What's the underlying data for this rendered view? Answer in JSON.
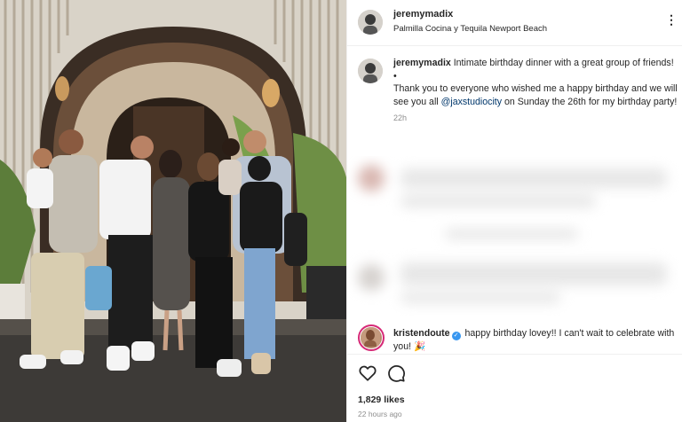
{
  "post": {
    "username": "jeremymadix",
    "location": "Palmilla Cocina y Tequila Newport Beach",
    "more_icon": "more-dots-icon"
  },
  "caption": {
    "username": "jeremymadix",
    "text_1": " Intimate birthday dinner with a great group of friends!",
    "bullet": "•",
    "text_2": "Thank you to everyone who wished me a happy birthday and we will see you all ",
    "mention": "@jaxstudiocity",
    "text_3": " on Sunday the 26th for my birthday party!",
    "time": "22h"
  },
  "comment": {
    "username": "kristendoute",
    "verified_icon": "verified-badge-icon",
    "text": " happy birthday lovey!! I can't wait to celebrate with you! ",
    "emoji": "🎉"
  },
  "actions": {
    "like_icon": "heart-icon",
    "comment_icon": "comment-bubble-icon",
    "likes": "1,829 likes",
    "timestamp": "22 hours ago"
  },
  "colors": {
    "link": "#00376b",
    "muted": "#8e8e8e",
    "verified": "#3897f0",
    "story_ring": "#d62976"
  }
}
